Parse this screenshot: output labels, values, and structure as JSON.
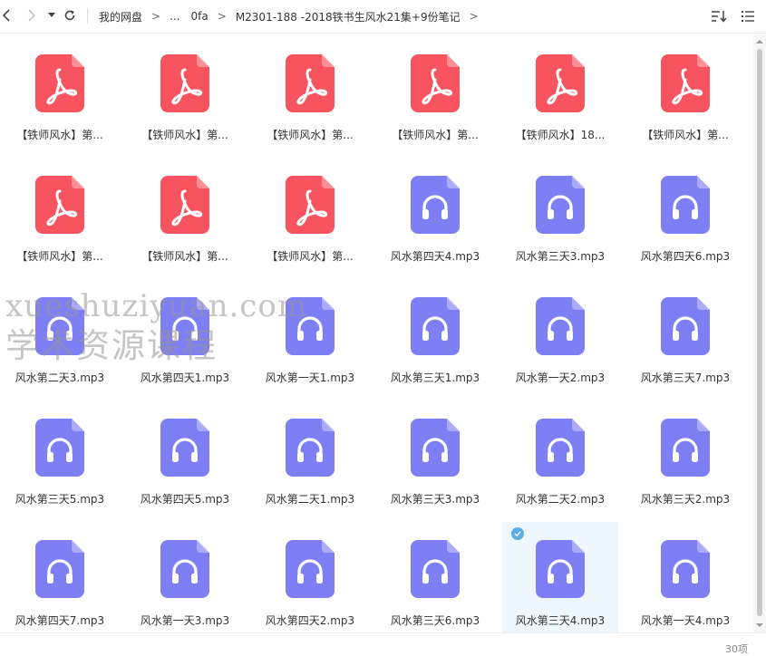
{
  "toolbar": {
    "back_glyph": "‹",
    "forward_glyph": "›",
    "dropdown_glyph": "▾",
    "breadcrumb": [
      {
        "label": "我的网盘"
      },
      {
        "label": "..."
      },
      {
        "label": "0fa"
      },
      {
        "label": "M2301-188 -2018铁书生风水21集+9份笔记"
      }
    ],
    "breadcrumb_sep": ">",
    "colors": {
      "accent": "#5aaee6"
    }
  },
  "files": [
    {
      "name": "【铁师风水】第...",
      "type": "pdf"
    },
    {
      "name": "【铁师风水】第...",
      "type": "pdf"
    },
    {
      "name": "【铁师风水】第...",
      "type": "pdf"
    },
    {
      "name": "【铁师风水】第...",
      "type": "pdf"
    },
    {
      "name": "【铁师风水】18...",
      "type": "pdf"
    },
    {
      "name": "【铁师风水】第...",
      "type": "pdf"
    },
    {
      "name": "【铁师风水】第...",
      "type": "pdf"
    },
    {
      "name": "【铁师风水】第...",
      "type": "pdf"
    },
    {
      "name": "【铁师风水】第...",
      "type": "pdf"
    },
    {
      "name": "风水第四天4.mp3",
      "type": "mp3"
    },
    {
      "name": "风水第三天3.mp3",
      "type": "mp3"
    },
    {
      "name": "风水第四天6.mp3",
      "type": "mp3"
    },
    {
      "name": "风水第二天3.mp3",
      "type": "mp3"
    },
    {
      "name": "风水第四天1.mp3",
      "type": "mp3"
    },
    {
      "name": "风水第一天1.mp3",
      "type": "mp3"
    },
    {
      "name": "风水第三天1.mp3",
      "type": "mp3"
    },
    {
      "name": "风水第一天2.mp3",
      "type": "mp3"
    },
    {
      "name": "风水第三天7.mp3",
      "type": "mp3"
    },
    {
      "name": "风水第三天5.mp3",
      "type": "mp3"
    },
    {
      "name": "风水第四天5.mp3",
      "type": "mp3"
    },
    {
      "name": "风水第二天1.mp3",
      "type": "mp3"
    },
    {
      "name": "风水第三天3.mp3",
      "type": "mp3"
    },
    {
      "name": "风水第二天2.mp3",
      "type": "mp3"
    },
    {
      "name": "风水第三天2.mp3",
      "type": "mp3"
    },
    {
      "name": "风水第四天7.mp3",
      "type": "mp3"
    },
    {
      "name": "风水第一天3.mp3",
      "type": "mp3"
    },
    {
      "name": "风水第四天2.mp3",
      "type": "mp3"
    },
    {
      "name": "风水第三天6.mp3",
      "type": "mp3"
    },
    {
      "name": "风水第三天4.mp3",
      "type": "mp3",
      "selected": true
    },
    {
      "name": "风水第一天4.mp3",
      "type": "mp3"
    }
  ],
  "icon_colors": {
    "pdf": "#f8545f",
    "mp3": "#7f7ff5"
  },
  "status": {
    "count": "30项"
  },
  "watermark": {
    "line1": "xueshuziyuan.com",
    "line2": "学术资源课程"
  }
}
